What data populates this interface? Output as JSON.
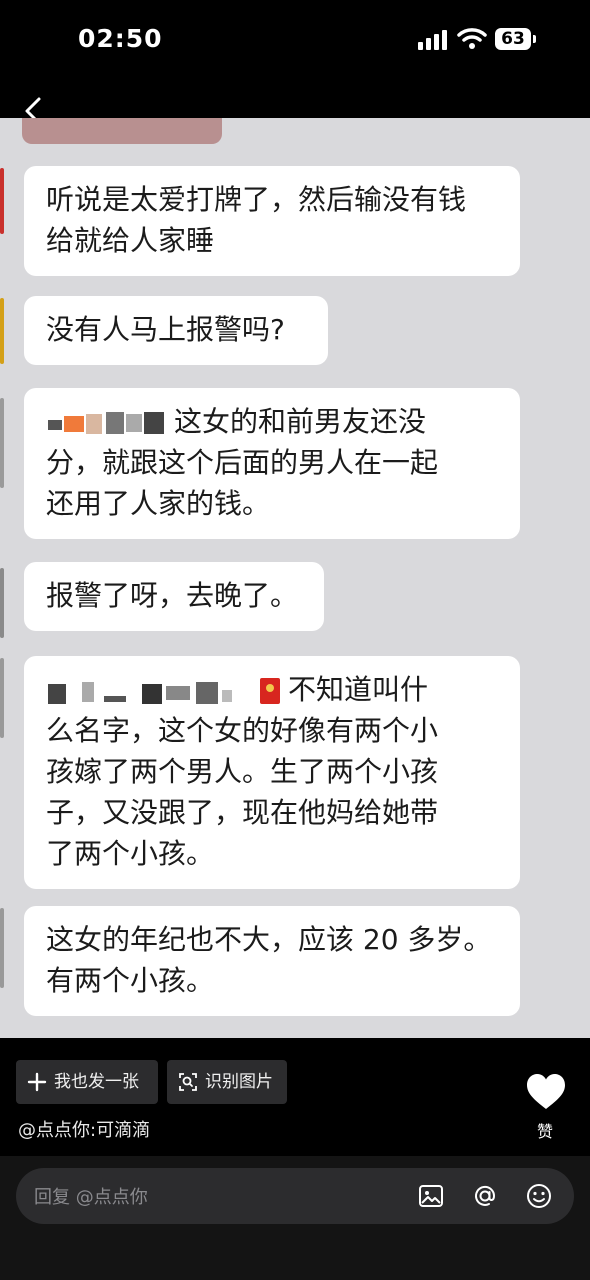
{
  "status": {
    "time": "02:50",
    "battery": "63"
  },
  "messages": [
    {
      "lines": [
        "听说是太爱打牌了，然后输没有钱",
        "给就给人家睡"
      ]
    },
    {
      "lines": [
        "没有人马上报警吗?"
      ]
    },
    {
      "lines": [
        "这女的和前男友还没",
        "分，就跟这个后面的男人在一起",
        "还用了人家的钱。"
      ]
    },
    {
      "lines": [
        "报警了呀，去晚了。"
      ]
    },
    {
      "lines": [
        "不知道叫什",
        "么名字，这个女的好像有两个小",
        "孩嫁了两个男人。生了两个小孩",
        "子，又没跟了，现在他妈给她带",
        "了两个小孩。"
      ]
    },
    {
      "lines": [
        "这女的年纪也不大，应该 20 多岁。",
        "有两个小孩。"
      ]
    }
  ],
  "actions": {
    "post_label": "我也发一张",
    "recognize_label": "识别图片",
    "author": "@点点你:可滴滴",
    "like_label": "赞"
  },
  "reply": {
    "placeholder": "回复 @点点你"
  },
  "icons": [
    "back-icon",
    "signal-icon",
    "wifi-icon",
    "battery-icon",
    "plus-icon",
    "scan-icon",
    "heart-icon",
    "image-icon",
    "at-icon",
    "emoji-icon",
    "red-envelope-icon"
  ]
}
